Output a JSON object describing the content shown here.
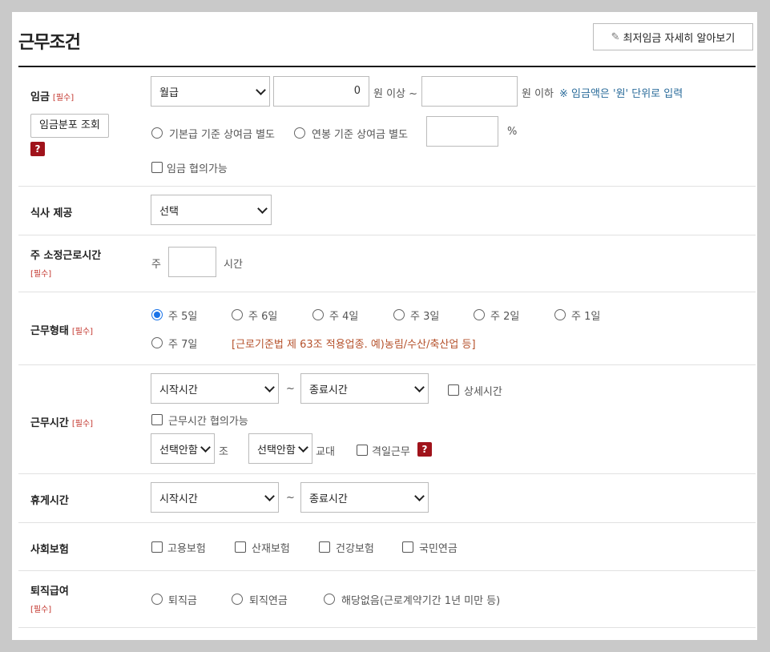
{
  "header": {
    "title": "근무조건",
    "min_wage_button": "최저임금 자세히 알아보기"
  },
  "required_label": "[필수]",
  "wage": {
    "label": "임금",
    "type_select": "월급",
    "min_value": "0",
    "unit_above": "원 이상 ~",
    "max_value": "",
    "unit_below": "원 이하",
    "note": "※ 임금액은 '원' 단위로 입력",
    "distribution_button": "임금분포 조회",
    "bonus_option_base": "기본급 기준 상여금 별도",
    "bonus_option_annual": "연봉 기준 상여금 별도",
    "bonus_percent": "",
    "percent_unit": "%",
    "negotiable": "임금 협의가능"
  },
  "meal": {
    "label": "식사 제공",
    "select": "선택"
  },
  "weekly_hours": {
    "label": "주 소정근로시간",
    "prefix": "주",
    "value": "",
    "unit": "시간"
  },
  "work_type": {
    "label": "근무형태",
    "options": [
      "주 5일",
      "주 6일",
      "주 4일",
      "주 3일",
      "주 2일",
      "주 1일",
      "주 7일"
    ],
    "selected_index": 0,
    "note": "[근로기준법 제 63조 적용업종. 예)농림/수산/축산업 등]"
  },
  "work_hours": {
    "label": "근무시간",
    "start": "시작시간",
    "tilde": "~",
    "end": "종료시간",
    "detail": "상세시간",
    "negotiable": "근무시간 협의가능",
    "shift_group": "선택안함",
    "shift_group_unit": "조",
    "shift_rotation": "선택안함",
    "shift_rotation_unit": "교대",
    "alternate_day": "격일근무"
  },
  "break_time": {
    "label": "휴게시간",
    "start": "시작시간",
    "tilde": "~",
    "end": "종료시간"
  },
  "insurance": {
    "label": "사회보험",
    "options": [
      "고용보험",
      "산재보험",
      "건강보험",
      "국민연금"
    ]
  },
  "severance": {
    "label": "퇴직급여",
    "options": [
      "퇴직금",
      "퇴직연금",
      "해당없음(근로계약기간 1년 미만 등)"
    ]
  },
  "help_icon_text": "?"
}
